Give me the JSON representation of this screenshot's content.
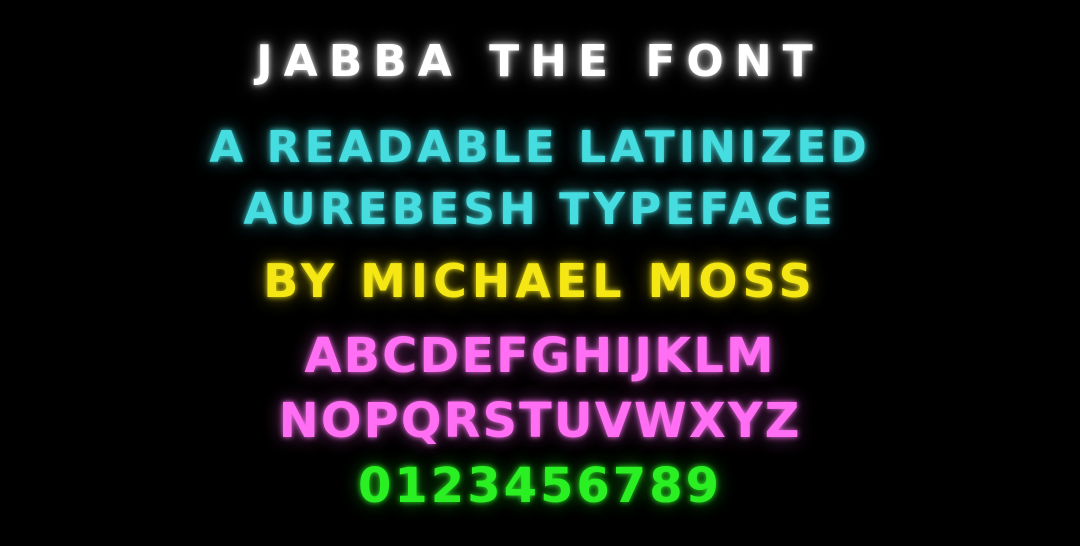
{
  "title": "Jabba the Font",
  "subtitle": {
    "line1": "A readable latinized",
    "line2": "Aurebesh typeface"
  },
  "author": "By Michael Moss",
  "alphabet": {
    "line1": "ABCDEFGHIJKLM",
    "line2": "NOPQRSTUVWXYZ"
  },
  "digits": "0123456789",
  "colors": {
    "background": "#000000",
    "title": "#ffffff",
    "subtitle": "#46dde0",
    "author": "#f4e714",
    "alphabet": "#ff6ef3",
    "digits": "#2aef23"
  }
}
